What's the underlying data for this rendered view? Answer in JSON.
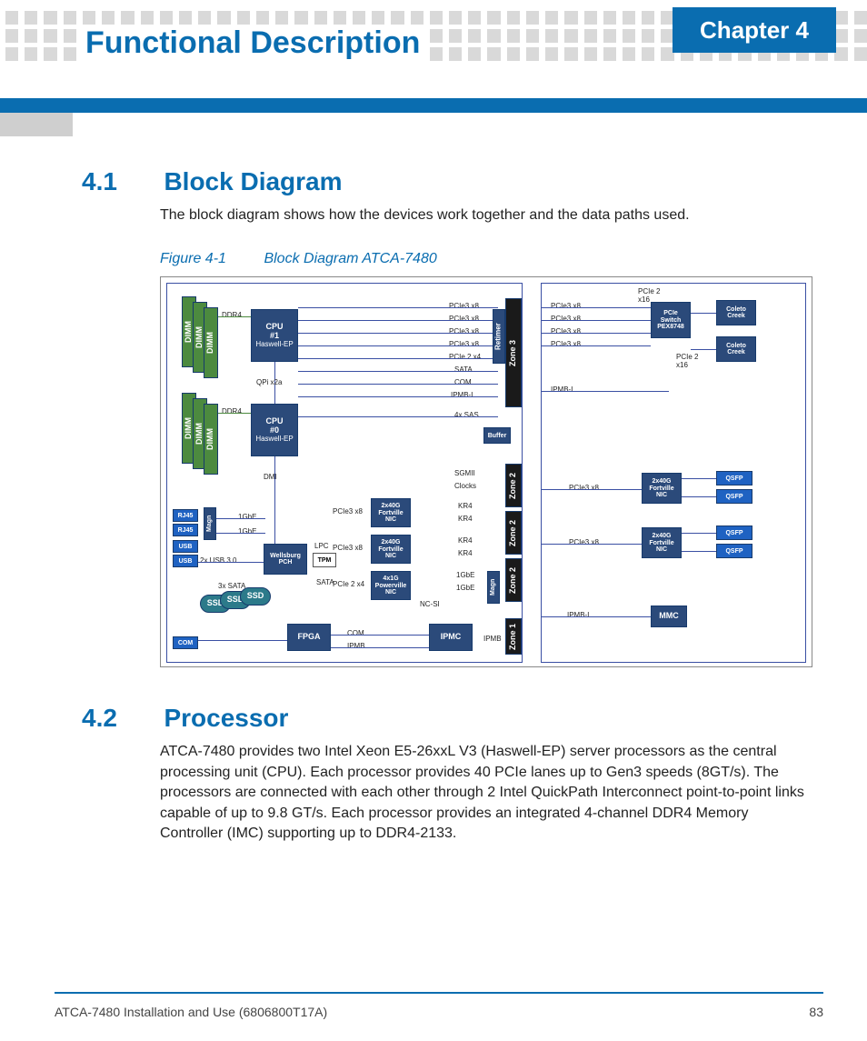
{
  "chapter_label": "Chapter 4",
  "page_title": "Functional Description",
  "section1": {
    "num": "4.1",
    "title": "Block Diagram",
    "text": "The block diagram shows how the devices work together and the data paths used.",
    "figure_label": "Figure 4-1",
    "figure_title": "Block Diagram ATCA-7480"
  },
  "section2": {
    "num": "4.2",
    "title": "Processor",
    "text": "ATCA-7480 provides two Intel Xeon E5-26xxL V3 (Haswell-EP) server processors as the central processing unit (CPU). Each processor provides 40 PCIe lanes up to Gen3 speeds (8GT/s). The processors are connected with each other through 2 Intel QuickPath Interconnect point-to-point links capable of up to 9.8 GT/s. Each processor provides an integrated 4-channel DDR4 Memory Controller (IMC) supporting up to DDR4-2133."
  },
  "diagram": {
    "dimm": "DIMM",
    "cpu1": "CPU\n#1",
    "cpu0": "CPU\n#0",
    "haswell": "Haswell-EP",
    "ddr4": "DDR4",
    "qpi": "QPi x2a",
    "dmi": "DMI",
    "retimer": "Retimer",
    "buffer": "Buffer",
    "zone3": "Zone 3",
    "zone2": "Zone 2",
    "zone1": "Zone 1",
    "rj45": "RJ45",
    "usb": "USB",
    "com": "COM",
    "magn": "Magn",
    "ssd": "SSD",
    "pch": "Wellsburg\nPCH",
    "tpm": "TPM",
    "lpc": "LPC",
    "fpga": "FPGA",
    "ipmc": "IPMC",
    "mmc": "MMC",
    "fortville": "2x40G\nFortville\nNIC",
    "powerville": "4x1G\nPowerville\nNIC",
    "ngsi": "NC-SI",
    "pex": "PCIe\nSwitch\nPEX8748",
    "coleto": "Coleto\nCreek",
    "qsfp": "QSFP",
    "buses": {
      "pcie3x8": "PCIe3 x8",
      "pcie2x4": "PCIe 2 x4",
      "pcie2x16": "PCIe 2\nx16",
      "sata": "SATA",
      "com_l": "COM",
      "ipmbl": "IPMB-L",
      "ipmb": "IPMB",
      "sas4": "4x SAS",
      "gbe1": "1GbE",
      "sgmii": "SGMII",
      "clocks": "Clocks",
      "kr4": "KR4",
      "usb3": "2x USB 3.0",
      "sata3": "3x SATA"
    }
  },
  "footer_left": "ATCA-7480 Installation and Use (6806800T17A)",
  "footer_right": "83"
}
